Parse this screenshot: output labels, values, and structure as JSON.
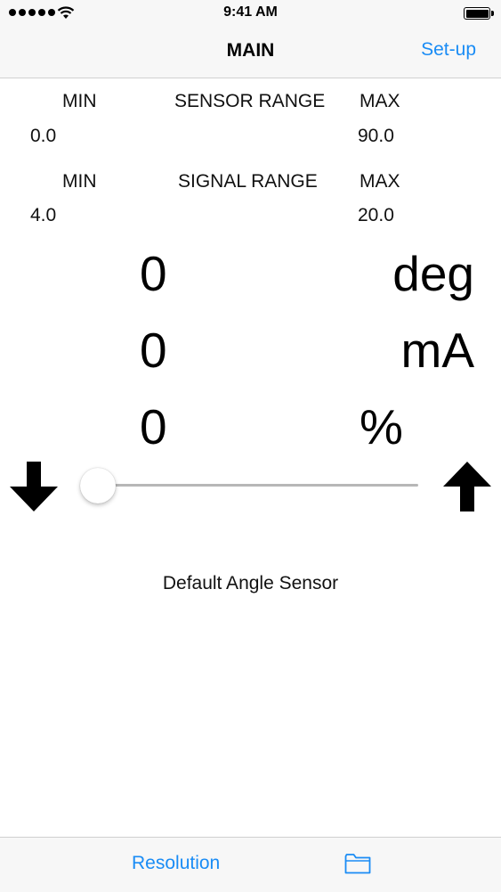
{
  "status_bar": {
    "time": "9:41 AM"
  },
  "nav": {
    "title": "MAIN",
    "right_button": "Set-up"
  },
  "sensor_range": {
    "title": "SENSOR RANGE",
    "min_label": "MIN",
    "max_label": "MAX",
    "min_value": "0.0",
    "max_value": "90.0"
  },
  "signal_range": {
    "title": "SIGNAL RANGE",
    "min_label": "MIN",
    "max_label": "MAX",
    "min_value": "4.0",
    "max_value": "20.0"
  },
  "readouts": [
    {
      "value": "0",
      "unit": "deg"
    },
    {
      "value": "0",
      "unit": "mA"
    },
    {
      "value": "0",
      "unit": "%"
    }
  ],
  "slider": {
    "level": 0
  },
  "sensor_name": "Default Angle Sensor",
  "toolbar": {
    "resolution_label": "Resolution"
  },
  "colors": {
    "accent": "#1a8cf5",
    "bar_background": "#f7f7f7",
    "slider_track": "#b7b7b7"
  },
  "icons": [
    "wifi-icon",
    "battery-icon",
    "arrow-down-icon",
    "arrow-up-icon",
    "folder-icon"
  ]
}
